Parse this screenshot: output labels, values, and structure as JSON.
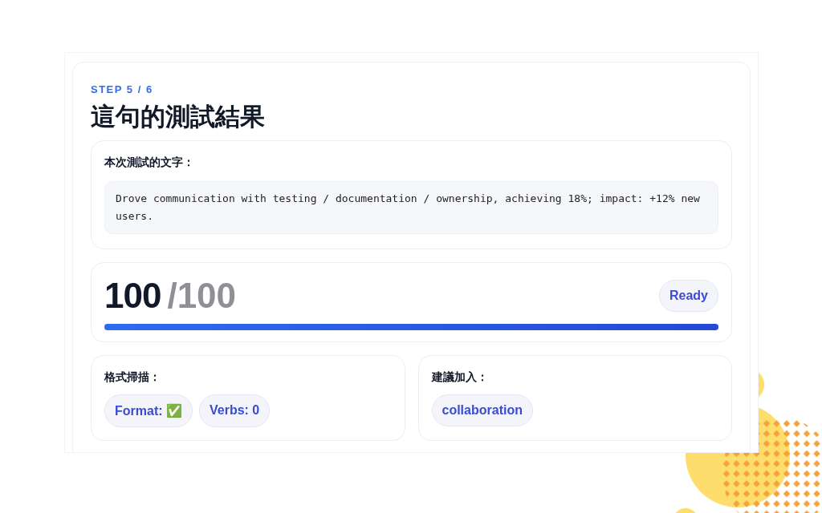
{
  "step": "STEP 5 / 6",
  "title": "這句的測試結果",
  "sample": {
    "label": "本次測試的文字：",
    "text": "Drove communication with testing / documentation / ownership, achieving 18%; impact: +12% new users."
  },
  "score": {
    "value": "100",
    "total": "/100",
    "badge": "Ready",
    "level": 1
  },
  "format_scan": {
    "label": "格式掃描：",
    "chips": [
      "Format: ✅",
      "Verbs: 0"
    ]
  },
  "suggestions": {
    "label": "建議加入：",
    "chips": [
      "collaboration"
    ]
  }
}
